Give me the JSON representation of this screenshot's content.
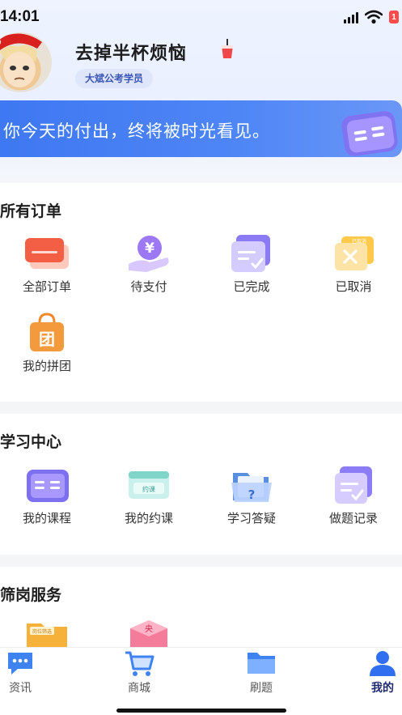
{
  "status_bar": {
    "time": "14:01",
    "battery": "1"
  },
  "profile": {
    "name": "去掉半杯烦恼",
    "badge": "大斌公考学员"
  },
  "banner": {
    "text": "你今天的付出，终将被时光看见。"
  },
  "orders": {
    "title": "所有订单",
    "items": [
      {
        "label": "全部订单",
        "icon": "card-icon"
      },
      {
        "label": "待支付",
        "icon": "yen-hand-icon"
      },
      {
        "label": "已完成",
        "icon": "doc-check-icon"
      },
      {
        "label": "已取消",
        "icon": "cancelled-doc-icon",
        "icon_text": "已取消"
      },
      {
        "label": "我的拼团",
        "icon": "shopping-bag-icon",
        "icon_text": "团"
      }
    ]
  },
  "study": {
    "title": "学习中心",
    "items": [
      {
        "label": "我的课程",
        "icon": "book-icon"
      },
      {
        "label": "我的约课",
        "icon": "appointment-card-icon",
        "icon_text": "约课"
      },
      {
        "label": "学习答疑",
        "icon": "question-folder-icon"
      },
      {
        "label": "做题记录",
        "icon": "exercise-record-icon"
      }
    ]
  },
  "station": {
    "title": "筛岗服务",
    "items": [
      {
        "label": "",
        "icon": "position-folder-icon",
        "icon_text": "岗位筛选"
      },
      {
        "label": "",
        "icon": "central-cube-icon",
        "icon_text": "央"
      }
    ]
  },
  "tabbar": {
    "items": [
      {
        "label": "资讯",
        "icon": "chat-bubble-icon",
        "active": false
      },
      {
        "label": "商城",
        "icon": "cart-icon",
        "active": false
      },
      {
        "label": "刷题",
        "icon": "folder-icon",
        "active": false
      },
      {
        "label": "我的",
        "icon": "user-icon",
        "active": true
      }
    ]
  },
  "colors": {
    "accent": "#3e78f2",
    "active_tab": "#1e2a6b",
    "badge_bg": "#dfe6fb",
    "badge_text": "#3b57b5",
    "battery": "#ff4b4b"
  }
}
